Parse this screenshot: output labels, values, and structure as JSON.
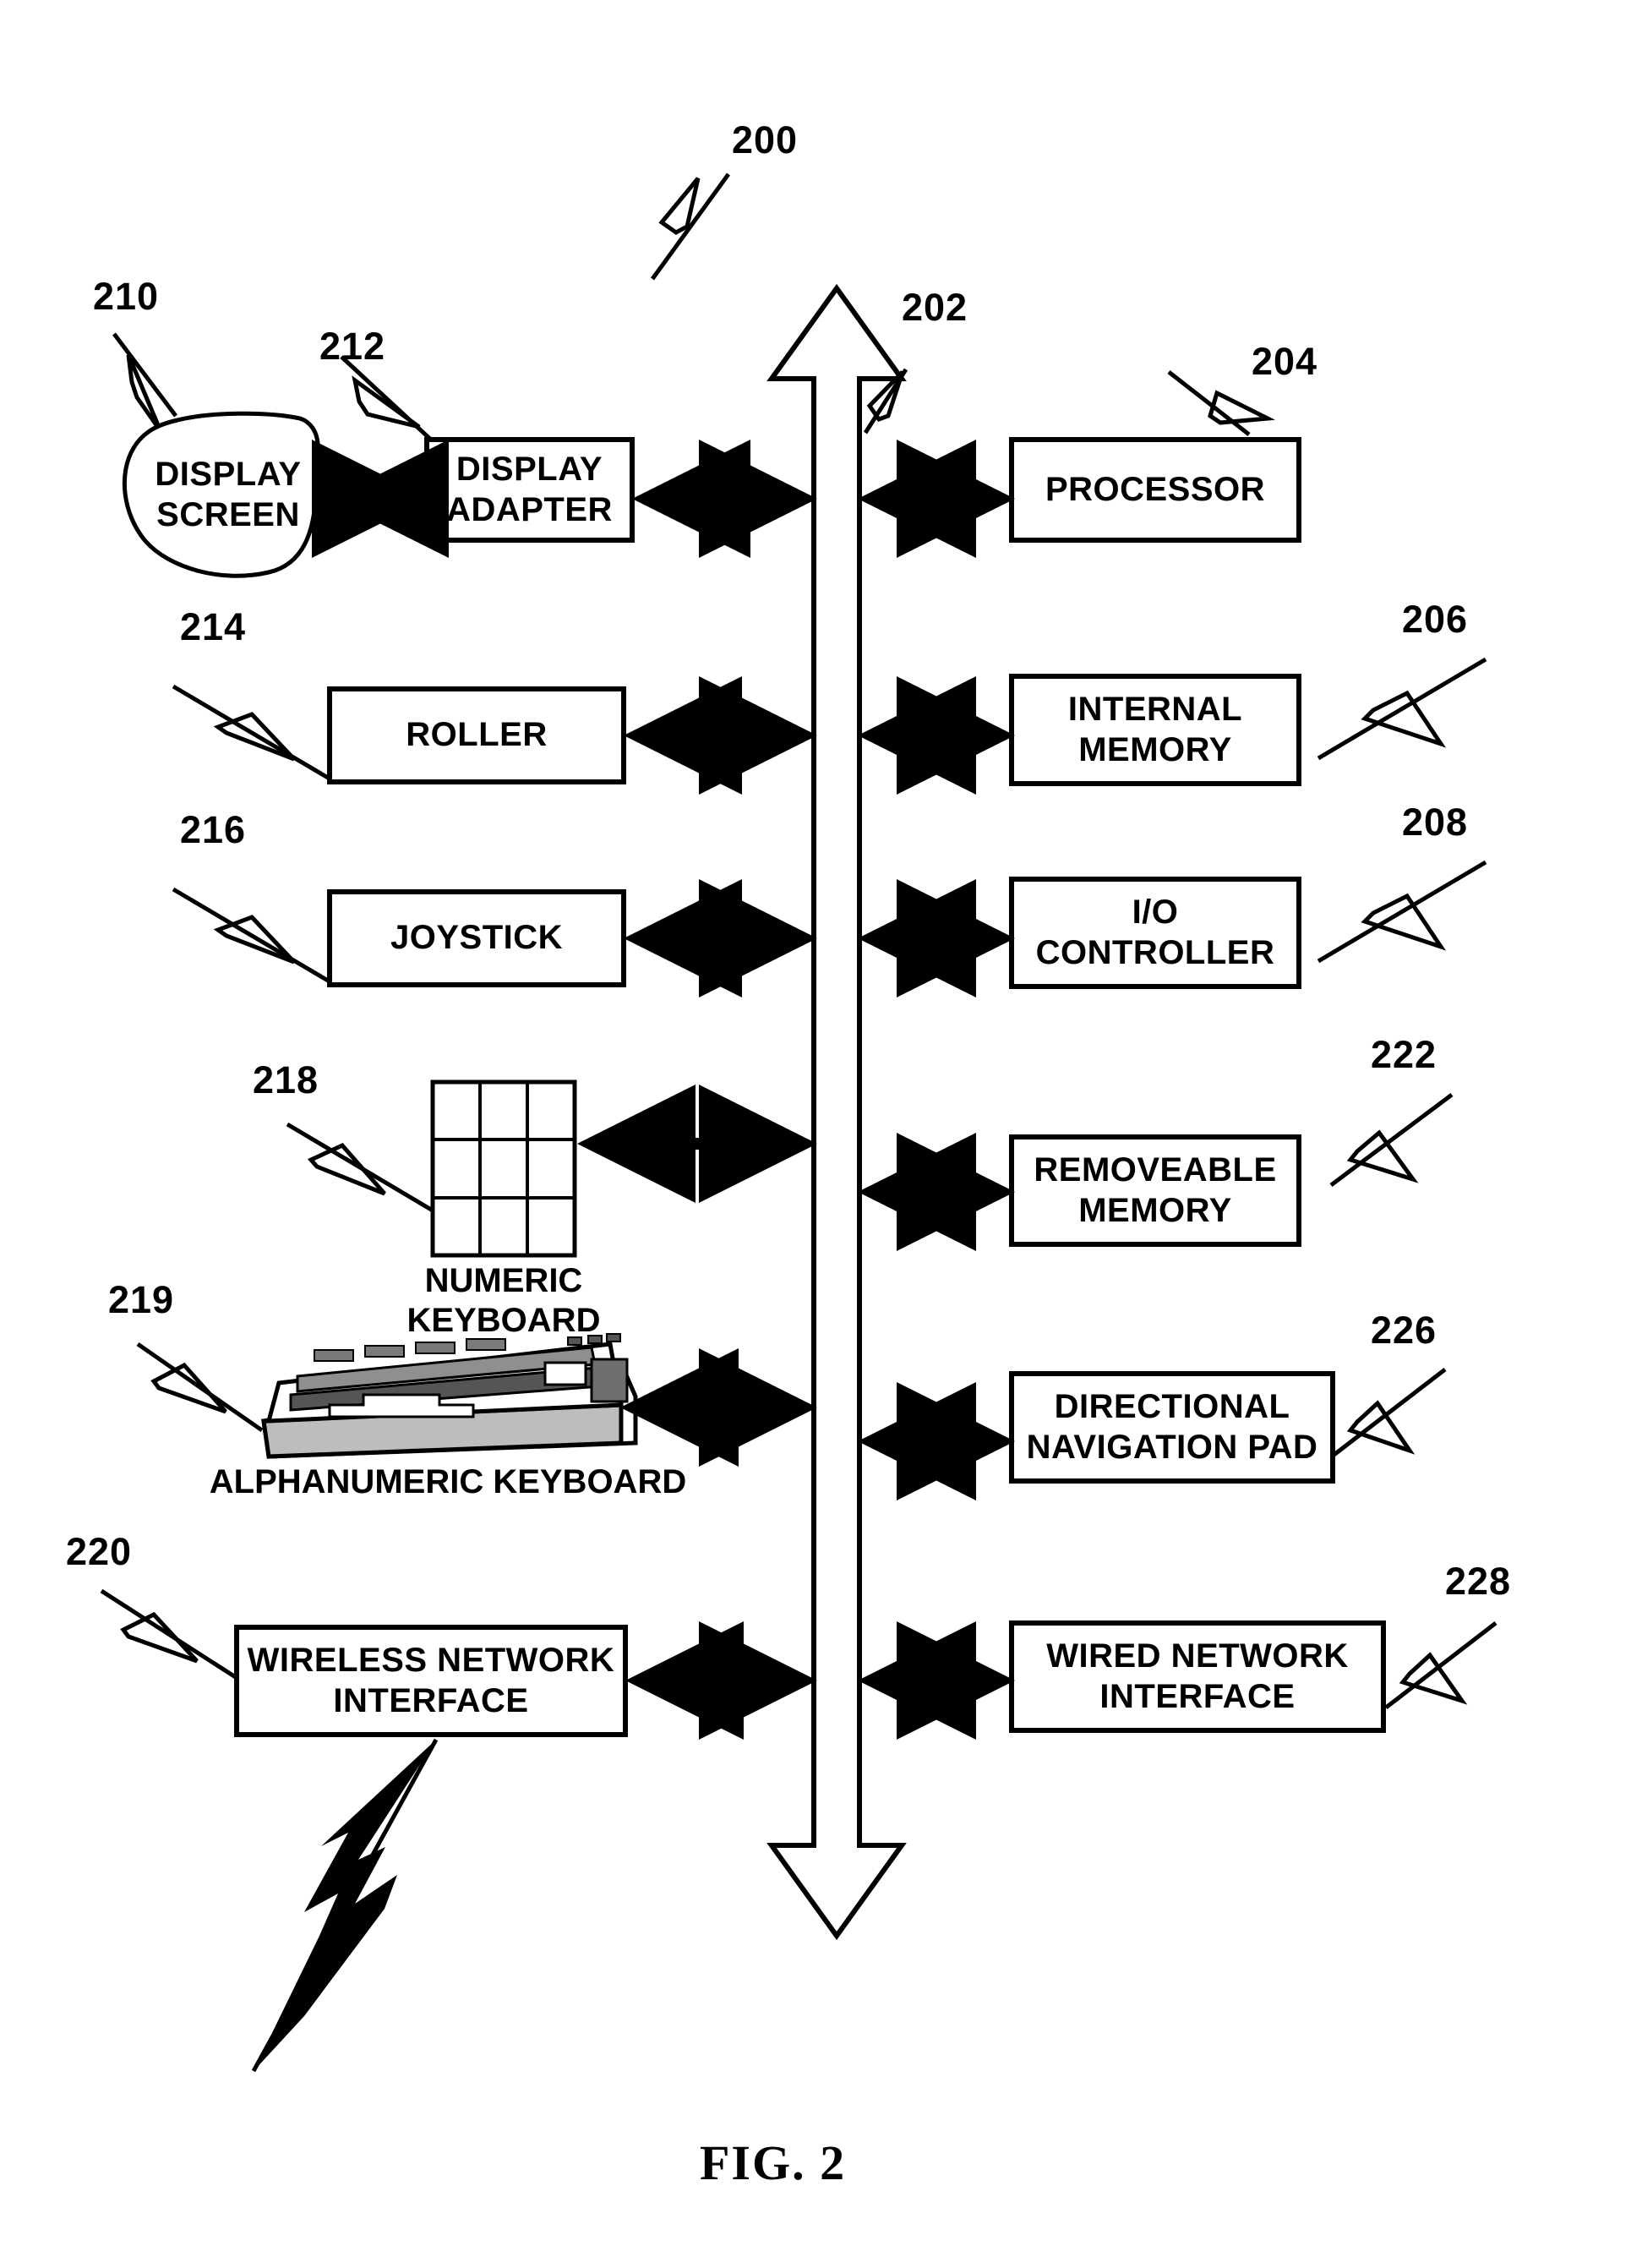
{
  "figure": {
    "caption": "FIG. 2",
    "system_ref": "200"
  },
  "bus": {
    "ref": "202",
    "name": "system bus"
  },
  "nodes": [
    {
      "id": "display-screen",
      "label": "DISPLAY\nSCREEN",
      "ref": "210",
      "shape": "blob",
      "side": "left"
    },
    {
      "id": "display-adapter",
      "label": "DISPLAY\nADAPTER",
      "ref": "212",
      "shape": "rect",
      "side": "left"
    },
    {
      "id": "processor",
      "label": "PROCESSOR",
      "ref": "204",
      "shape": "rect",
      "side": "right"
    },
    {
      "id": "roller",
      "label": "ROLLER",
      "ref": "214",
      "shape": "rect",
      "side": "left"
    },
    {
      "id": "internal-memory",
      "label": "INTERNAL\nMEMORY",
      "ref": "206",
      "shape": "rect",
      "side": "right"
    },
    {
      "id": "joystick",
      "label": "JOYSTICK",
      "ref": "216",
      "shape": "rect",
      "side": "left"
    },
    {
      "id": "io-controller",
      "label": "I/O\nCONTROLLER",
      "ref": "208",
      "shape": "rect",
      "side": "right"
    },
    {
      "id": "numeric-keyboard",
      "label": "NUMERIC\nKEYBOARD",
      "ref": "218",
      "shape": "grid-icon",
      "side": "left"
    },
    {
      "id": "removeable-memory",
      "label": "REMOVEABLE\nMEMORY",
      "ref": "222",
      "shape": "rect",
      "side": "right"
    },
    {
      "id": "alphanumeric-keyboard",
      "label": "ALPHANUMERIC KEYBOARD",
      "ref": "219",
      "shape": "keyboard-icon",
      "side": "left"
    },
    {
      "id": "directional-navigation-pad",
      "label": "DIRECTIONAL\nNAVIGATION PAD",
      "ref": "226",
      "shape": "rect",
      "side": "right"
    },
    {
      "id": "wireless-network-interface",
      "label": "WIRELESS NETWORK\nINTERFACE",
      "ref": "220",
      "shape": "rect",
      "side": "left"
    },
    {
      "id": "wired-network-interface",
      "label": "WIRED NETWORK\nINTERFACE",
      "ref": "228",
      "shape": "rect",
      "side": "right"
    }
  ],
  "colors": {
    "ink": "#000000",
    "paper": "#ffffff"
  }
}
